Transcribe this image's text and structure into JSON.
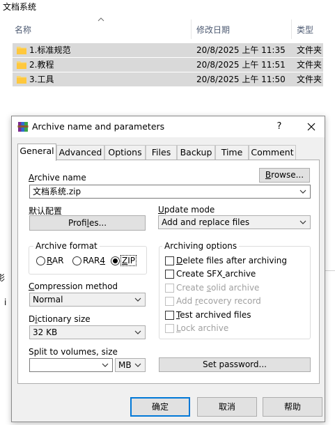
{
  "explorer": {
    "folder_title": "文档系统",
    "columns": {
      "name": "名称",
      "date": "修改日期",
      "type": "类型"
    },
    "rows": [
      {
        "name": "1.标准规范",
        "date": "20/8/2025 上午 11:35",
        "type": "文件夹"
      },
      {
        "name": "2.教程",
        "date": "20/8/2025 上午 11:51",
        "type": "文件夹"
      },
      {
        "name": "3.工具",
        "date": "20/8/2025 上午 11:50",
        "type": "文件夹"
      }
    ],
    "fragments": {
      "left1": "影",
      "left2": "i"
    }
  },
  "dialog": {
    "title": "Archive name and parameters",
    "help_label": "?",
    "tabs": [
      "General",
      "Advanced",
      "Options",
      "Files",
      "Backup",
      "Time",
      "Comment"
    ],
    "active_tab": "General",
    "archive_name_label": "Archive name",
    "browse_label": "Browse...",
    "archive_name_value": "文档系统.zip",
    "profile_heading": "默认配置",
    "profiles_label": "Profiles...",
    "update_mode_label": "Update mode",
    "update_mode_value": "Add and replace files",
    "archive_format": {
      "title": "Archive format",
      "options": [
        "RAR",
        "RAR4",
        "ZIP"
      ],
      "selected": "ZIP"
    },
    "compression_label": "Compression method",
    "compression_value": "Normal",
    "dictionary_label": "Dictionary size",
    "dictionary_value": "32 KB",
    "split_label": "Split to volumes, size",
    "split_value": "",
    "split_unit": "MB",
    "archiving_options": {
      "title": "Archiving options",
      "items": [
        {
          "label": "Delete files after archiving",
          "checked": false,
          "enabled": true
        },
        {
          "label": "Create SFX archive",
          "checked": false,
          "enabled": true
        },
        {
          "label": "Create solid archive",
          "checked": false,
          "enabled": false
        },
        {
          "label": "Add recovery record",
          "checked": false,
          "enabled": false
        },
        {
          "label": "Test archived files",
          "checked": false,
          "enabled": true
        },
        {
          "label": "Lock archive",
          "checked": false,
          "enabled": false
        }
      ]
    },
    "set_password_label": "Set password...",
    "ok_label": "确定",
    "cancel_label": "取消",
    "help_button_label": "帮助"
  }
}
